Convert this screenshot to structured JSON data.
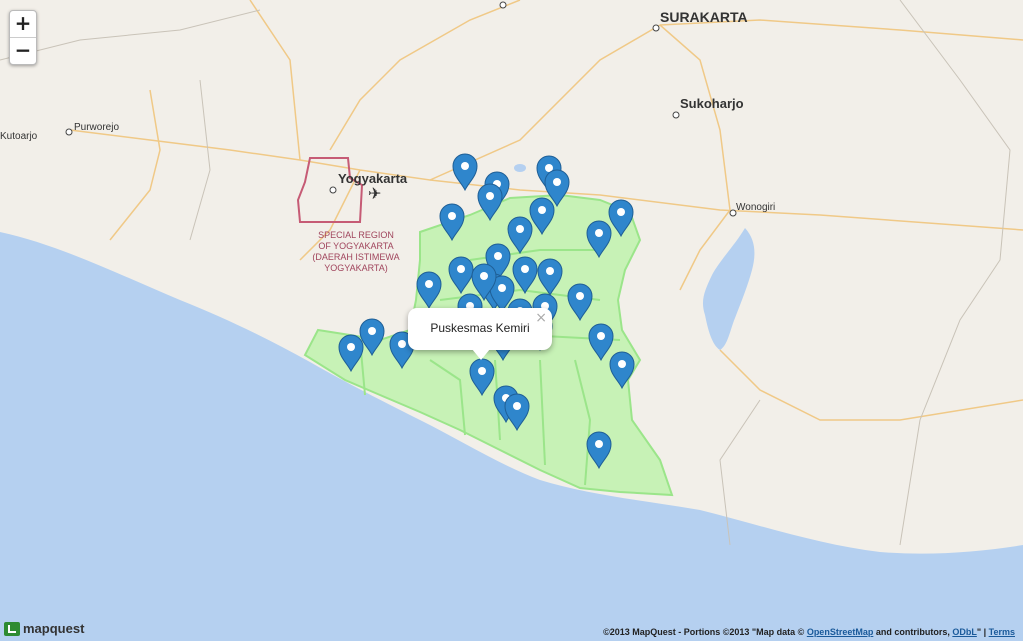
{
  "map": {
    "zoom_in": "+",
    "zoom_out": "−",
    "cities": [
      {
        "name": "SURAKARTA",
        "bold": true
      },
      {
        "name": "Sukoharjo",
        "bold": true
      },
      {
        "name": "Yogyakarta",
        "bold": true
      },
      {
        "name": "Purworejo",
        "bold": false
      },
      {
        "name": "Kutoarjo",
        "bold": false
      },
      {
        "name": "Wonogiri",
        "bold": false
      }
    ],
    "region_label": [
      "SPECIAL REGION",
      "OF YOGYAKARTA",
      "(DAERAH ISTIMEWA",
      "YOGYAKARTA)"
    ],
    "popup": {
      "text": "Puskesmas Kemiri",
      "close": "×"
    },
    "marker_count": 33,
    "colors": {
      "land": "#f2efe9",
      "water": "#b5d0f0",
      "region_fill": "#c7f2b6",
      "region_border": "#9be58a",
      "marker": "#2f86cc",
      "roads": "#f0c987"
    }
  },
  "attribution": {
    "prefix": "©2013 MapQuest  -  Portions ©2013 \"Map data © ",
    "osm_link": "OpenStreetMap",
    "middle": " and contributors, ",
    "odbl_link": "ODbL",
    "sep": "\" | ",
    "terms_link": "Terms"
  },
  "logo": {
    "text": "mapquest"
  }
}
